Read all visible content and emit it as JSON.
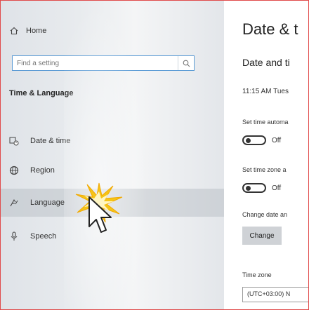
{
  "sidebar": {
    "home": {
      "label": "Home",
      "icon": "home-icon"
    },
    "search": {
      "placeholder": "Find a setting",
      "icon": "search-icon"
    },
    "section_title": "Time & Language",
    "items": [
      {
        "label": "Date & time",
        "icon": "calendar-clock-icon"
      },
      {
        "label": "Region",
        "icon": "globe-icon"
      },
      {
        "label": "Language",
        "icon": "language-icon",
        "active": true
      },
      {
        "label": "Speech",
        "icon": "microphone-icon"
      }
    ]
  },
  "content": {
    "title": "Date & t",
    "subtitle": "Date and ti",
    "time_line": "11:15 AM  Tues",
    "auto_time": {
      "label": "Set time automa",
      "state": "Off"
    },
    "auto_zone": {
      "label": "Set time zone a",
      "state": "Off"
    },
    "change_label": "Change date an",
    "change_button": "Change",
    "timezone_label": "Time zone",
    "timezone_value": "(UTC+03:00) N"
  },
  "colors": {
    "accent_border": "#5b9bd5",
    "frame_border": "#e04a4a",
    "cursor_highlight": "#f5c518"
  }
}
